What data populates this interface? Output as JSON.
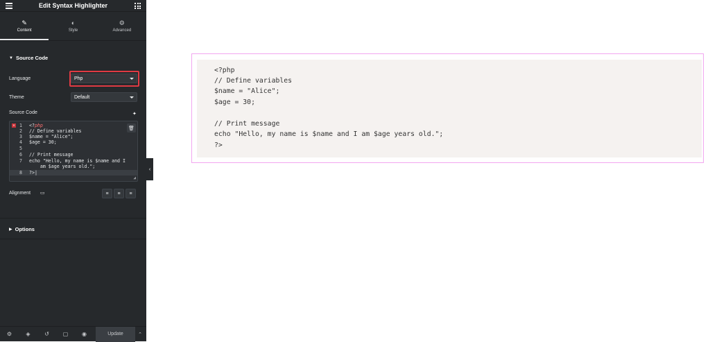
{
  "panel": {
    "title": "Edit Syntax Highlighter",
    "tabs": [
      {
        "label": "Content",
        "icon": "pencil-icon"
      },
      {
        "label": "Style",
        "icon": "half-circle-icon"
      },
      {
        "label": "Advanced",
        "icon": "gear-icon"
      }
    ],
    "source_section_title": "Source Code",
    "language_label": "Language",
    "language_value": "Php",
    "theme_label": "Theme",
    "theme_value": "Default",
    "source_code_label": "Source Code",
    "editor_lines": [
      {
        "num": "1",
        "prefix": "<?",
        "kw": "php",
        "rest": ""
      },
      {
        "num": "2",
        "text": "// Define variables"
      },
      {
        "num": "3",
        "text": "$name = \"Alice\";"
      },
      {
        "num": "4",
        "text": "$age = 30;"
      },
      {
        "num": "5",
        "text": ""
      },
      {
        "num": "6",
        "text": "// Print message"
      },
      {
        "num": "7",
        "text": "echo \"Hello, my name is $name and I"
      },
      {
        "num": "",
        "text": "    am $age years old.\";"
      },
      {
        "num": "8",
        "text": "?>|"
      }
    ],
    "alignment_label": "Alignment",
    "options_title": "Options",
    "footer": {
      "update_label": "Update"
    },
    "accent_color": "#e03a43"
  },
  "preview": {
    "code_lines": [
      "<?php",
      "// Define variables",
      "$name = \"Alice\";",
      "$age = 30;",
      "",
      "// Print message",
      "echo \"Hello, my name is $name and I am $age years old.\";",
      "?>"
    ],
    "frame_color": "#f2a6f0",
    "background_color": "#f5f2f0"
  }
}
